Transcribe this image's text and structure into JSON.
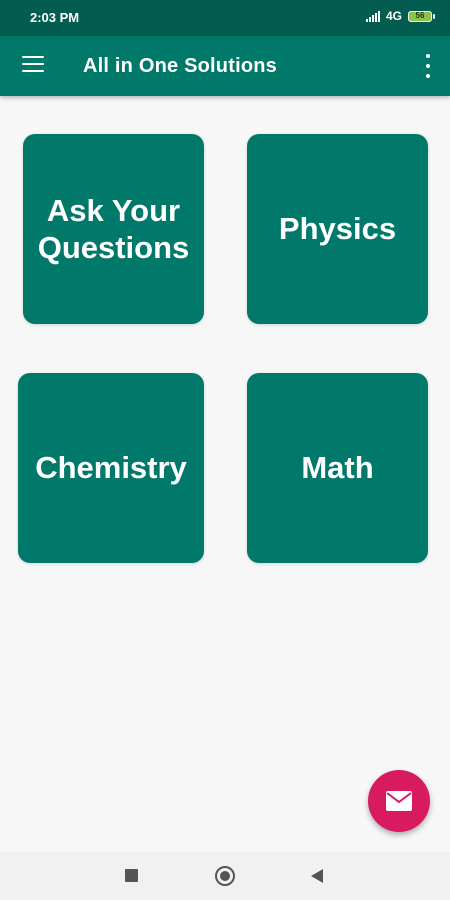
{
  "status_bar": {
    "time": "2:03 PM",
    "network": "4G",
    "battery": "56"
  },
  "app_bar": {
    "title": "All in One Solutions",
    "menu_icon": "hamburger-menu-icon",
    "overflow_icon": "more-vert-icon"
  },
  "tiles": [
    {
      "line1": "Ask Your",
      "line2": "Questions"
    },
    {
      "label": "Physics"
    },
    {
      "label": "Chemistry"
    },
    {
      "label": "Math"
    }
  ],
  "fab": {
    "icon": "email-icon"
  },
  "nav_bar": {
    "icons": [
      "recent-apps-icon",
      "home-icon",
      "back-icon"
    ]
  },
  "colors": {
    "status_bar": "#025c50",
    "primary": "#00796b",
    "accent": "#d81b60",
    "background": "#f7f7f7"
  }
}
